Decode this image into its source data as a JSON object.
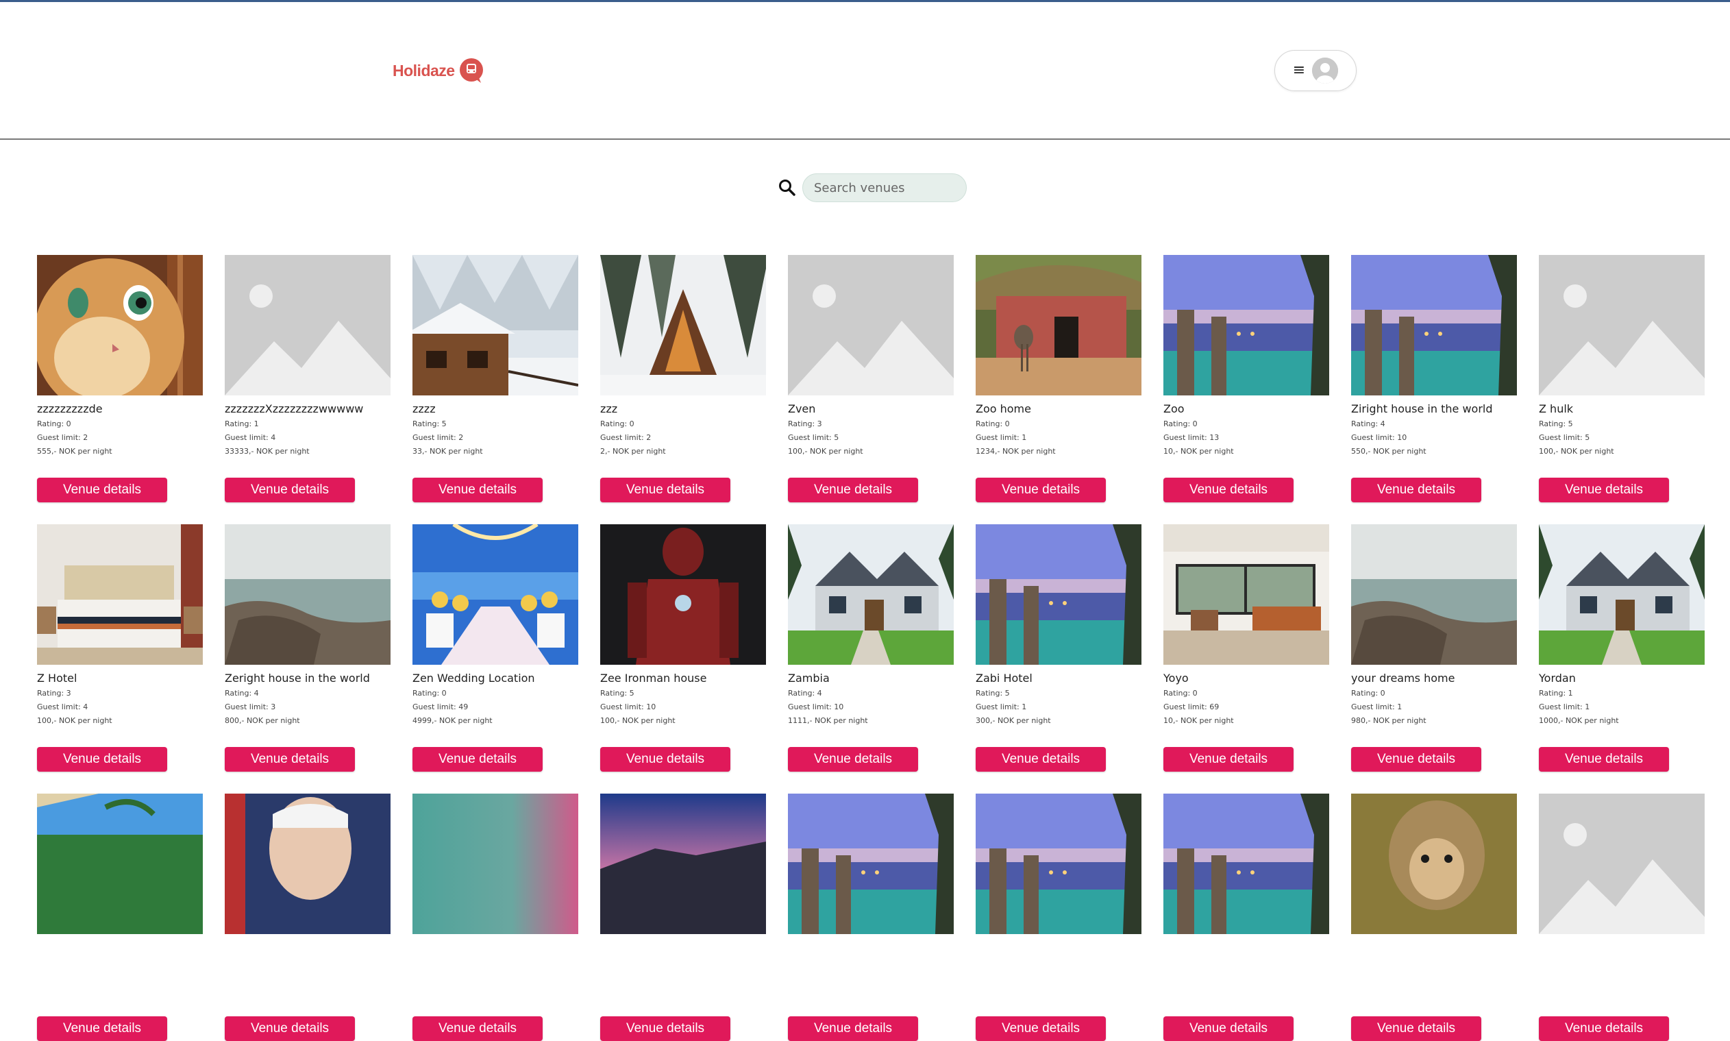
{
  "header": {
    "logo_text": "Holidaze"
  },
  "search": {
    "placeholder": "Search venues",
    "value": ""
  },
  "colors": {
    "accent": "#e0195a",
    "logo": "#d9534f",
    "search_bg": "#e6efeb"
  },
  "venues": [
    {
      "name": "zzzzzzzzzde",
      "rating": "Rating: 0",
      "guests": "Guest limit: 2",
      "price": "555,- NOK per night",
      "image": "cat"
    },
    {
      "name": "zzzzzzzXzzzzzzzzwwwww",
      "rating": "Rating: 1",
      "guests": "Guest limit: 4",
      "price": "33333,- NOK per night",
      "image": "placeholder"
    },
    {
      "name": "zzzz",
      "rating": "Rating: 5",
      "guests": "Guest limit: 2",
      "price": "33,- NOK per night",
      "image": "snow-cabin"
    },
    {
      "name": "zzz",
      "rating": "Rating: 0",
      "guests": "Guest limit: 2",
      "price": "2,- NOK per night",
      "image": "a-frame"
    },
    {
      "name": "Zven",
      "rating": "Rating: 3",
      "guests": "Guest limit: 5",
      "price": "100,- NOK per night",
      "image": "placeholder"
    },
    {
      "name": "Zoo home",
      "rating": "Rating: 0",
      "guests": "Guest limit: 1",
      "price": "1234,- NOK per night",
      "image": "zoo-hut"
    },
    {
      "name": "Zoo",
      "rating": "Rating: 0",
      "guests": "Guest limit: 13",
      "price": "10,- NOK per night",
      "image": "resort"
    },
    {
      "name": "Ziright house in the world",
      "rating": "Rating: 4",
      "guests": "Guest limit: 10",
      "price": "550,- NOK per night",
      "image": "resort"
    },
    {
      "name": "Z hulk",
      "rating": "Rating: 5",
      "guests": "Guest limit: 5",
      "price": "100,- NOK per night",
      "image": "placeholder"
    },
    {
      "name": "Z Hotel",
      "rating": "Rating: 3",
      "guests": "Guest limit: 4",
      "price": "100,- NOK per night",
      "image": "bedroom"
    },
    {
      "name": "Zeright house in the world",
      "rating": "Rating: 4",
      "guests": "Guest limit: 3",
      "price": "800,- NOK per night",
      "image": "coast"
    },
    {
      "name": "Zen Wedding Location",
      "rating": "Rating: 0",
      "guests": "Guest limit: 49",
      "price": "4999,- NOK per night",
      "image": "wedding"
    },
    {
      "name": "Zee Ironman house",
      "rating": "Rating: 5",
      "guests": "Guest limit: 10",
      "price": "100,- NOK per night",
      "image": "ironman"
    },
    {
      "name": "Zambia",
      "rating": "Rating: 4",
      "guests": "Guest limit: 10",
      "price": "1111,- NOK per night",
      "image": "house"
    },
    {
      "name": "Zabi Hotel",
      "rating": "Rating: 5",
      "guests": "Guest limit: 1",
      "price": "300,- NOK per night",
      "image": "resort"
    },
    {
      "name": "Yoyo",
      "rating": "Rating: 0",
      "guests": "Guest limit: 69",
      "price": "10,- NOK per night",
      "image": "living-room"
    },
    {
      "name": "your dreams home",
      "rating": "Rating: 0",
      "guests": "Guest limit: 1",
      "price": "980,- NOK per night",
      "image": "coast"
    },
    {
      "name": "Yordan",
      "rating": "Rating: 1",
      "guests": "Guest limit: 1",
      "price": "1000,- NOK per night",
      "image": "house"
    },
    {
      "name": "",
      "rating": "",
      "guests": "",
      "price": "",
      "image": "beach-palms"
    },
    {
      "name": "",
      "rating": "",
      "guests": "",
      "price": "",
      "image": "portrait"
    },
    {
      "name": "",
      "rating": "",
      "guests": "",
      "price": "",
      "image": "blur"
    },
    {
      "name": "",
      "rating": "",
      "guests": "",
      "price": "",
      "image": "sunset-mountain"
    },
    {
      "name": "",
      "rating": "",
      "guests": "",
      "price": "",
      "image": "resort"
    },
    {
      "name": "",
      "rating": "",
      "guests": "",
      "price": "",
      "image": "resort"
    },
    {
      "name": "",
      "rating": "",
      "guests": "",
      "price": "",
      "image": "resort"
    },
    {
      "name": "",
      "rating": "",
      "guests": "",
      "price": "",
      "image": "monkey"
    },
    {
      "name": "",
      "rating": "",
      "guests": "",
      "price": "",
      "image": "placeholder"
    }
  ],
  "card": {
    "button_label": "Venue details"
  }
}
